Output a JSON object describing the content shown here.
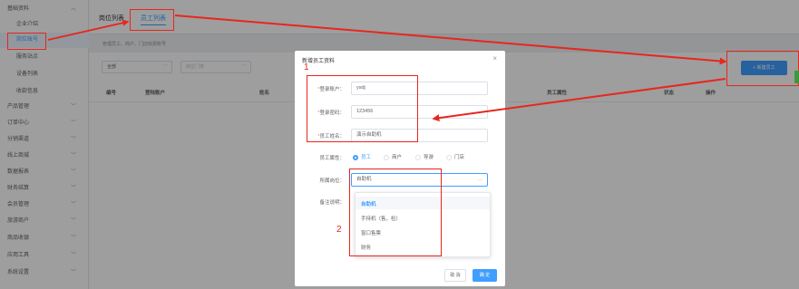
{
  "sidebar": {
    "items": [
      {
        "label": "基础资料",
        "chevron": "^"
      },
      {
        "label": "企业介绍"
      },
      {
        "label": "岗位账号"
      },
      {
        "label": "服务站点"
      },
      {
        "label": "设备列表"
      },
      {
        "label": "收款信息"
      },
      {
        "label": "产品管理",
        "chevron": "v"
      },
      {
        "label": "订单中心",
        "chevron": "v"
      },
      {
        "label": "分销渠道",
        "chevron": "v"
      },
      {
        "label": "线上商城",
        "chevron": "v"
      },
      {
        "label": "数据报表",
        "chevron": "v"
      },
      {
        "label": "财务结算",
        "chevron": "v"
      },
      {
        "label": "会员管理",
        "chevron": "v"
      },
      {
        "label": "旅游商户",
        "chevron": "v"
      },
      {
        "label": "商品收银",
        "chevron": "v"
      },
      {
        "label": "应用工具",
        "chevron": "v"
      },
      {
        "label": "系统设置",
        "chevron": "v"
      }
    ]
  },
  "tabs": {
    "tab1": "岗位列表",
    "tab2": "员工列表"
  },
  "description": "管理员工、商户、门店收费账号",
  "filters": {
    "status": "全部",
    "dept": "岗位门类"
  },
  "add_button": "+ 新建员工",
  "table": {
    "headers": [
      "编号",
      "登陆账户",
      "姓名",
      "员工属性",
      "状态",
      "操作"
    ]
  },
  "dialog": {
    "title": "新增员工资料",
    "close": "×",
    "fields": {
      "account_label": "登录账户：",
      "account_value": "ysdj",
      "password_label": "登录密码：",
      "password_value": "123456",
      "name_label": "员工姓名：",
      "name_value": "演示自助机",
      "attr_label": "员工属性：",
      "post_label": "所属岗位：",
      "post_value": "自助机",
      "remark_label": "备注说明："
    },
    "attr_options": [
      "员工",
      "商户",
      "导游",
      "门店"
    ],
    "post_options": [
      "自助机",
      "手持机（售，检）",
      "窗口售票",
      "财务"
    ],
    "cancel": "取 消",
    "confirm": "确 定"
  },
  "annotations": {
    "num1": "1",
    "num2": "2"
  },
  "colors": {
    "accent": "#409eff",
    "annotation": "#e8261d"
  }
}
